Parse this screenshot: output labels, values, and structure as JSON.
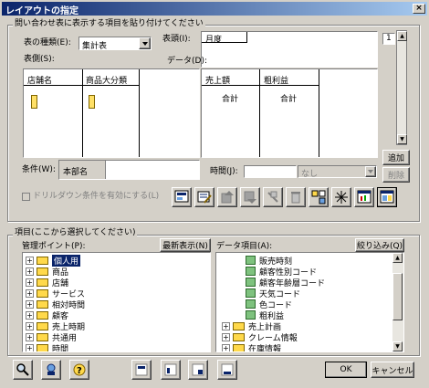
{
  "window": {
    "title": "レイアウトの指定",
    "close": "×"
  },
  "top_group": {
    "title": "問い合わせ表に表示する項目を貼り付けてください",
    "table_type_label": "表の種類(E):",
    "table_type_value": "集計表",
    "header_label": "表頭(I):",
    "header_field": "月度",
    "side_label": "表側(S):",
    "data_label": "データ(D):",
    "page_number": "1",
    "side_columns": [
      "店舗名",
      "商品大分類"
    ],
    "data_columns": [
      "売上額",
      "粗利益"
    ],
    "data_values": [
      "合計",
      "合計"
    ],
    "add_button": "追加",
    "delete_button": "削除",
    "condition_label": "条件(W):",
    "condition_field": "本部名",
    "time_label": "時間(J):",
    "time_value": "なし",
    "drilldown_checkbox": "ドリルダウン条件を有効にする(L)"
  },
  "bottom_group": {
    "title": "項目(ここから選択してください)",
    "mgmt_label": "管理ポイント(P):",
    "refresh_button": "最新表示(N)",
    "data_items_label": "データ項目(A):",
    "filter_button": "絞り込み(Q)",
    "mgmt_tree": [
      "個人用",
      "商品",
      "店舗",
      "サービス",
      "相対時間",
      "顧客",
      "売上時期",
      "共通用",
      "時間"
    ],
    "data_tree": [
      {
        "label": "販売時刻",
        "kind": "leaf"
      },
      {
        "label": "顧客性別コード",
        "kind": "leaf"
      },
      {
        "label": "顧客年齢層コード",
        "kind": "leaf"
      },
      {
        "label": "天気コード",
        "kind": "leaf"
      },
      {
        "label": "色コード",
        "kind": "leaf"
      },
      {
        "label": "粗利益",
        "kind": "leaf"
      },
      {
        "label": "売上計画",
        "kind": "folder"
      },
      {
        "label": "クレーム情報",
        "kind": "folder"
      },
      {
        "label": "在庫情報",
        "kind": "folder"
      }
    ]
  },
  "footer": {
    "ok": "OK",
    "cancel": "キャンセル"
  },
  "colors": {
    "title_start": "#0a246a",
    "title_end": "#a6caf0",
    "highlight": "#0a246a",
    "face": "#d4d0c8"
  }
}
